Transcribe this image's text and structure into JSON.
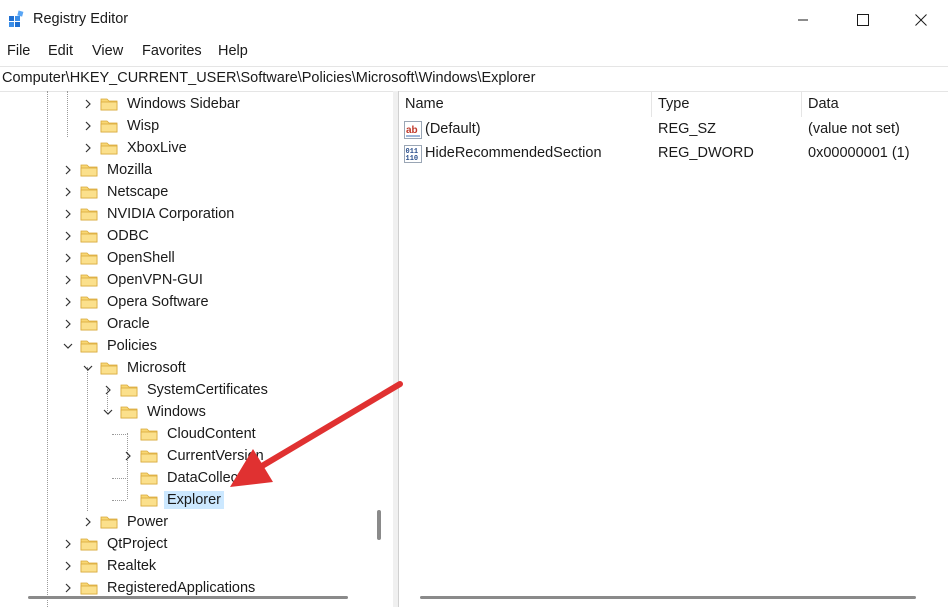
{
  "window": {
    "title": "Registry Editor",
    "icon": "registry-icon"
  },
  "menu": [
    "File",
    "Edit",
    "View",
    "Favorites",
    "Help"
  ],
  "address": "Computer\\HKEY_CURRENT_USER\\Software\\Policies\\Microsoft\\Windows\\Explorer",
  "tree": [
    {
      "label": "Windows Sidebar",
      "expander": "collapsed"
    },
    {
      "label": "Wisp",
      "expander": "collapsed"
    },
    {
      "label": "XboxLive",
      "expander": "collapsed"
    },
    {
      "label": "Mozilla",
      "expander": "collapsed"
    },
    {
      "label": "Netscape",
      "expander": "collapsed"
    },
    {
      "label": "NVIDIA Corporation",
      "expander": "collapsed"
    },
    {
      "label": "ODBC",
      "expander": "collapsed"
    },
    {
      "label": "OpenShell",
      "expander": "collapsed"
    },
    {
      "label": "OpenVPN-GUI",
      "expander": "collapsed"
    },
    {
      "label": "Opera Software",
      "expander": "collapsed"
    },
    {
      "label": "Oracle",
      "expander": "collapsed"
    },
    {
      "label": "Policies",
      "expander": "expanded"
    },
    {
      "label": "Microsoft",
      "expander": "expanded"
    },
    {
      "label": "SystemCertificates",
      "expander": "collapsed"
    },
    {
      "label": "Windows",
      "expander": "expanded"
    },
    {
      "label": "CloudContent",
      "expander": "none"
    },
    {
      "label": "CurrentVersion",
      "expander": "collapsed"
    },
    {
      "label": "DataCollection",
      "expander": "none"
    },
    {
      "label": "Explorer",
      "expander": "none",
      "selected": true
    },
    {
      "label": "Power",
      "expander": "collapsed"
    },
    {
      "label": "QtProject",
      "expander": "collapsed"
    },
    {
      "label": "Realtek",
      "expander": "collapsed"
    },
    {
      "label": "RegisteredApplications",
      "expander": "collapsed"
    }
  ],
  "list": {
    "columns": [
      "Name",
      "Type",
      "Data"
    ],
    "rows": [
      {
        "icon": "string-value-icon",
        "name": "(Default)",
        "type": "REG_SZ",
        "data": "(value not set)"
      },
      {
        "icon": "binary-value-icon",
        "name": "HideRecommendedSection",
        "type": "REG_DWORD",
        "data": "0x00000001 (1)"
      }
    ]
  },
  "colors": {
    "selection": "#cce8ff",
    "folder": "#f8d775",
    "arrow": "#e03131"
  }
}
